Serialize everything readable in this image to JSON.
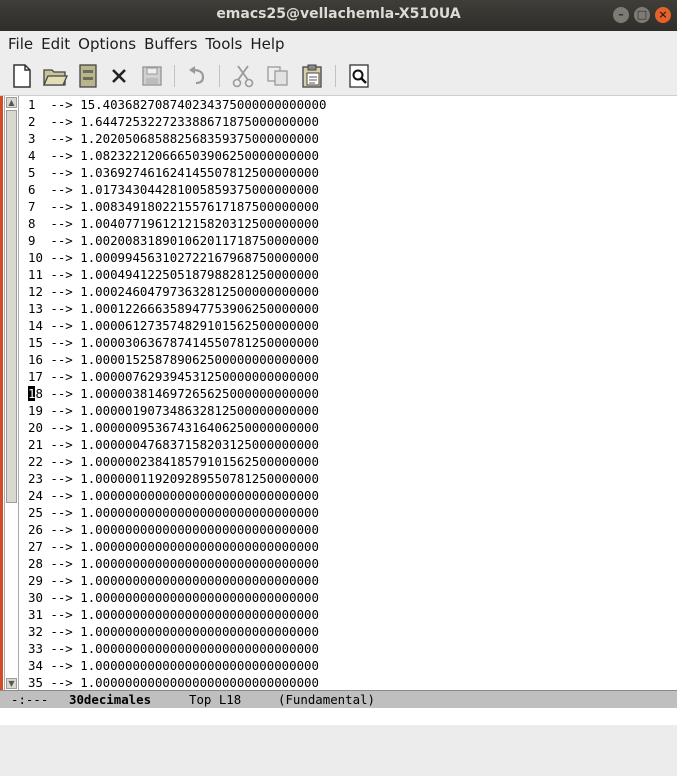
{
  "window": {
    "title": "emacs25@vellachemla-X510UA",
    "buttons": {
      "minimize": "–",
      "maximize": "□",
      "close": "×"
    }
  },
  "menubar": {
    "items": [
      "File",
      "Edit",
      "Options",
      "Buffers",
      "Tools",
      "Help"
    ]
  },
  "toolbar": {
    "icons": [
      "new-file-icon",
      "open-folder-icon",
      "dired-icon",
      "close-buffer-icon",
      "save-icon",
      "undo-icon",
      "cut-icon",
      "copy-icon",
      "paste-icon",
      "search-icon"
    ]
  },
  "buffer": {
    "cursor_line": 18,
    "lines": [
      {
        "n": "1 ",
        "v": "15.403682708740234375000000000000"
      },
      {
        "n": "2 ",
        "v": "1.644725322723388671875000000000"
      },
      {
        "n": "3 ",
        "v": "1.202050685882568359375000000000"
      },
      {
        "n": "4 ",
        "v": "1.082322120666503906250000000000"
      },
      {
        "n": "5 ",
        "v": "1.036927461624145507812500000000"
      },
      {
        "n": "6 ",
        "v": "1.017343044281005859375000000000"
      },
      {
        "n": "7 ",
        "v": "1.008349180221557617187500000000"
      },
      {
        "n": "8 ",
        "v": "1.004077196121215820312500000000"
      },
      {
        "n": "9 ",
        "v": "1.002008318901062011718750000000"
      },
      {
        "n": "10",
        "v": "1.000994563102722167968750000000"
      },
      {
        "n": "11",
        "v": "1.000494122505187988281250000000"
      },
      {
        "n": "12",
        "v": "1.000246047973632812500000000000"
      },
      {
        "n": "13",
        "v": "1.000122666358947753906250000000"
      },
      {
        "n": "14",
        "v": "1.000061273574829101562500000000"
      },
      {
        "n": "15",
        "v": "1.000030636787414550781250000000"
      },
      {
        "n": "16",
        "v": "1.000015258789062500000000000000"
      },
      {
        "n": "17",
        "v": "1.000007629394531250000000000000"
      },
      {
        "n": "18",
        "v": "1.000003814697265625000000000000"
      },
      {
        "n": "19",
        "v": "1.000001907348632812500000000000"
      },
      {
        "n": "20",
        "v": "1.000000953674316406250000000000"
      },
      {
        "n": "21",
        "v": "1.000000476837158203125000000000"
      },
      {
        "n": "22",
        "v": "1.000000238418579101562500000000"
      },
      {
        "n": "23",
        "v": "1.000000119209289550781250000000"
      },
      {
        "n": "24",
        "v": "1.000000000000000000000000000000"
      },
      {
        "n": "25",
        "v": "1.000000000000000000000000000000"
      },
      {
        "n": "26",
        "v": "1.000000000000000000000000000000"
      },
      {
        "n": "27",
        "v": "1.000000000000000000000000000000"
      },
      {
        "n": "28",
        "v": "1.000000000000000000000000000000"
      },
      {
        "n": "29",
        "v": "1.000000000000000000000000000000"
      },
      {
        "n": "30",
        "v": "1.000000000000000000000000000000"
      },
      {
        "n": "31",
        "v": "1.000000000000000000000000000000"
      },
      {
        "n": "32",
        "v": "1.000000000000000000000000000000"
      },
      {
        "n": "33",
        "v": "1.000000000000000000000000000000"
      },
      {
        "n": "34",
        "v": "1.000000000000000000000000000000"
      },
      {
        "n": "35",
        "v": "1.000000000000000000000000000000"
      }
    ],
    "arrow": "-->"
  },
  "modeline": {
    "status": "-:---",
    "buffer_name": "30decimales",
    "position": "Top L18",
    "mode": "(Fundamental)"
  },
  "colors": {
    "titlebar": "#3f3e39",
    "close_button": "#e4612c",
    "modeline_bg": "#bfbfbf"
  }
}
